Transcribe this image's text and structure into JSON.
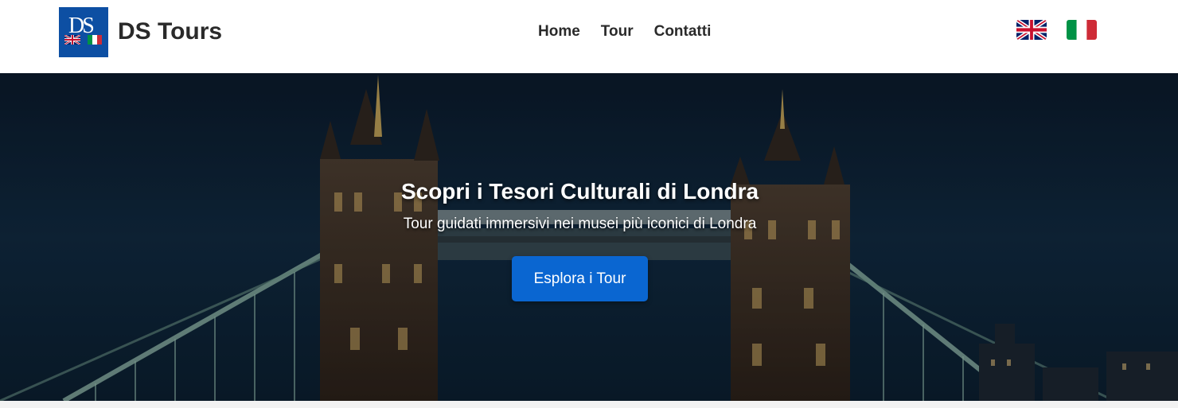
{
  "brand": {
    "logo_letters": "DS",
    "name": "DS Tours",
    "accent_color": "#0d4fa3"
  },
  "nav": {
    "links": [
      "Home",
      "Tour",
      "Contatti"
    ]
  },
  "languages": [
    {
      "icon": "uk-flag-icon",
      "code": "en"
    },
    {
      "icon": "italy-flag-icon",
      "code": "it"
    }
  ],
  "hero": {
    "title": "Scopri i Tesori Culturali di Londra",
    "subtitle": "Tour guidati immersivi nei musei più iconici di Londra",
    "cta_label": "Esplora i Tour",
    "cta_color": "#0a66d1"
  }
}
